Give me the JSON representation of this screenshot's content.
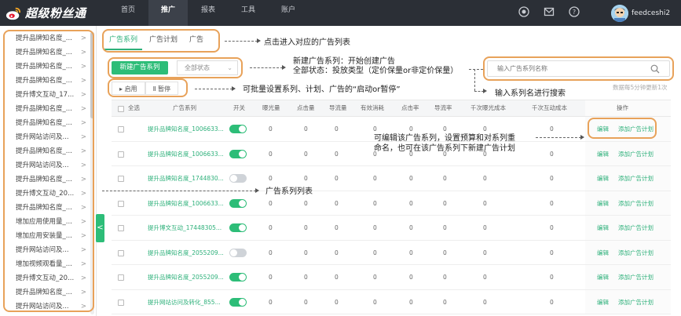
{
  "app": {
    "name": "超级粉丝通"
  },
  "nav": [
    "首页",
    "推广",
    "报表",
    "工具",
    "账户"
  ],
  "nav_active_index": 1,
  "user": {
    "name": "feedceshi2"
  },
  "sidebar": {
    "items": [
      "提升品牌知名度_...",
      "提升品牌知名度_...",
      "提升品牌知名度_...",
      "提升品牌知名度_...",
      "提升博文互动_17...",
      "提升品牌知名度_...",
      "提升品牌知名度_...",
      "提升网站访问及...",
      "提升品牌知名度_...",
      "提升网站访问及...",
      "提升品牌知名度_...",
      "提升博文互动_20...",
      "提升品牌知名度_...",
      "增加应用使用量_...",
      "增加应用安装量_...",
      "提升网站访问及...",
      "增加视频观看量_...",
      "提升博文互动_20...",
      "提升品牌知名度_...",
      "提升网站访问及..."
    ],
    "arrow": ">",
    "collapse": "<"
  },
  "tabs": [
    "广告系列",
    "广告计划",
    "广告"
  ],
  "toolbar": {
    "new_button": "新建广告系列",
    "status_select": "全部状态",
    "search_placeholder": "输入广告系列名称",
    "start": "启用",
    "pause": "暂停",
    "update_note": "数据每5分钟更新1次"
  },
  "table": {
    "headers": [
      "全选",
      "广告系列",
      "开关",
      "曝光量",
      "点击量",
      "导流量",
      "有效消耗",
      "点击率",
      "导流率",
      "千次曝光成本",
      "千次互动成本",
      "操作"
    ],
    "rows": [
      {
        "name": "提升品牌知名度_1006633...",
        "on": true
      },
      {
        "name": "提升品牌知名度_1006633...",
        "on": true
      },
      {
        "name": "提升品牌知名度_1744830...",
        "on": false
      },
      {
        "name": "提升品牌知名度_1006633...",
        "on": true
      },
      {
        "name": "提升博文互动_17448305...",
        "on": true
      },
      {
        "name": "提升品牌知名度_2055209...",
        "on": false
      },
      {
        "name": "提升品牌知名度_2055209...",
        "on": true
      },
      {
        "name": "提升网站访问及转化_855...",
        "on": true
      }
    ],
    "zero": "0",
    "edit": "编辑",
    "add_plan": "添加广告计划"
  },
  "annotations": {
    "tabs_note": "点击进入对应的广告列表",
    "new_note": "新建广告系列：开始创建广告",
    "status_note": "全部状态：投放类型（定价保量or非定价保量）",
    "search_note": "输入系列名进行搜索",
    "batch_note": "可批量设置系列、计划、广告的“启动or暂停”",
    "edit_note_1": "可编辑该广告系列，设置预算和对系列重",
    "edit_note_2": "命名，也可在该广告系列下新建广告计划",
    "list_note": "广告系列列表"
  },
  "colors": {
    "accent": "#2dbd78",
    "annotation": "#e8a25a",
    "topbar": "#2b2f36"
  }
}
